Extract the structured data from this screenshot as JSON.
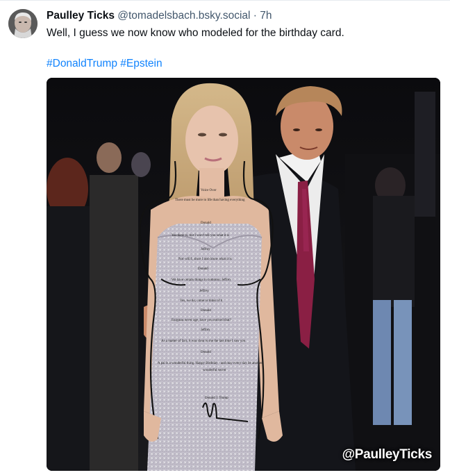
{
  "post": {
    "display_name": "Paulley Ticks",
    "handle": "@tomadelsbach.bsky.social",
    "separator": "·",
    "time": "7h",
    "text": "Well, I guess we now know who modeled for the birthday card.",
    "hashtags": [
      "#DonaldTrump",
      "#Epstein"
    ]
  },
  "media": {
    "watermark": "@PaulleyTicks"
  },
  "colors": {
    "link": "#1083fe",
    "secondary_text": "#42576c",
    "primary_text": "#0b0f14"
  },
  "icons": {
    "avatar": "user-avatar"
  }
}
